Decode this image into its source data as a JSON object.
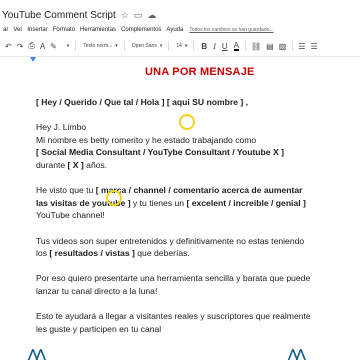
{
  "app": {
    "doc_title": "YouTube Comment Script",
    "save_status": "Todos los cambios se han guardado..."
  },
  "menu": [
    "ar",
    "Ver",
    "Insertar",
    "Formato",
    "Herramientas",
    "Complementos",
    "Ayuda"
  ],
  "toolbar": {
    "style_select": "Texto norm...",
    "font_select": "Open Sans",
    "font_size": "14",
    "bold": "B",
    "italic": "I",
    "underline": "U",
    "text_color": "A"
  },
  "document": {
    "heading": "UNA POR MENSAJE",
    "line_greeting_options": "[ Hey / Querido /  Que tal / Hola ] [ aqui SU nombre ] ,",
    "line_hey": "Hey J. Limbo",
    "line_intro": "Mi nombre es betty romerito y he estado trabajando como",
    "line_roles": "[ Social Media Consultant / YouTybe Consultant / Youtube X ]",
    "line_duration_a": "durante ",
    "line_duration_b": "[ X ]",
    "line_duration_c": " años.",
    "line_seen_a": "He visto que tu ",
    "line_seen_b": "[ marca / channel / comentario acerca de aumentar",
    "line_seen_c": "las visitas de youtube ]",
    "line_seen_d": " y tu tienes un  ",
    "line_seen_e": "[ excelent / increible / genial ]",
    "line_seen_f": "YouTube channel!",
    "line_videos_a": "Tus videos son super entretenidos y definitivamente no estas teniendo",
    "line_videos_b": "los ",
    "line_videos_c": "[ resultados / vistas ]",
    "line_videos_d": " que deberías.",
    "line_tool_a": "Por eso quiero presentarte una herramienta sencilla y barata que puede",
    "line_tool_b": "lanzar tu canal directo a la luna!",
    "line_help_a": "Esto te ayudará a llegar a visitantes reales y suscriptores que realmente",
    "line_help_b": "les guste y participen en tu canal"
  },
  "colors": {
    "heading": "#cc0000",
    "cursor_ring": "#f2d21b",
    "logo": "#0f5a8c"
  }
}
